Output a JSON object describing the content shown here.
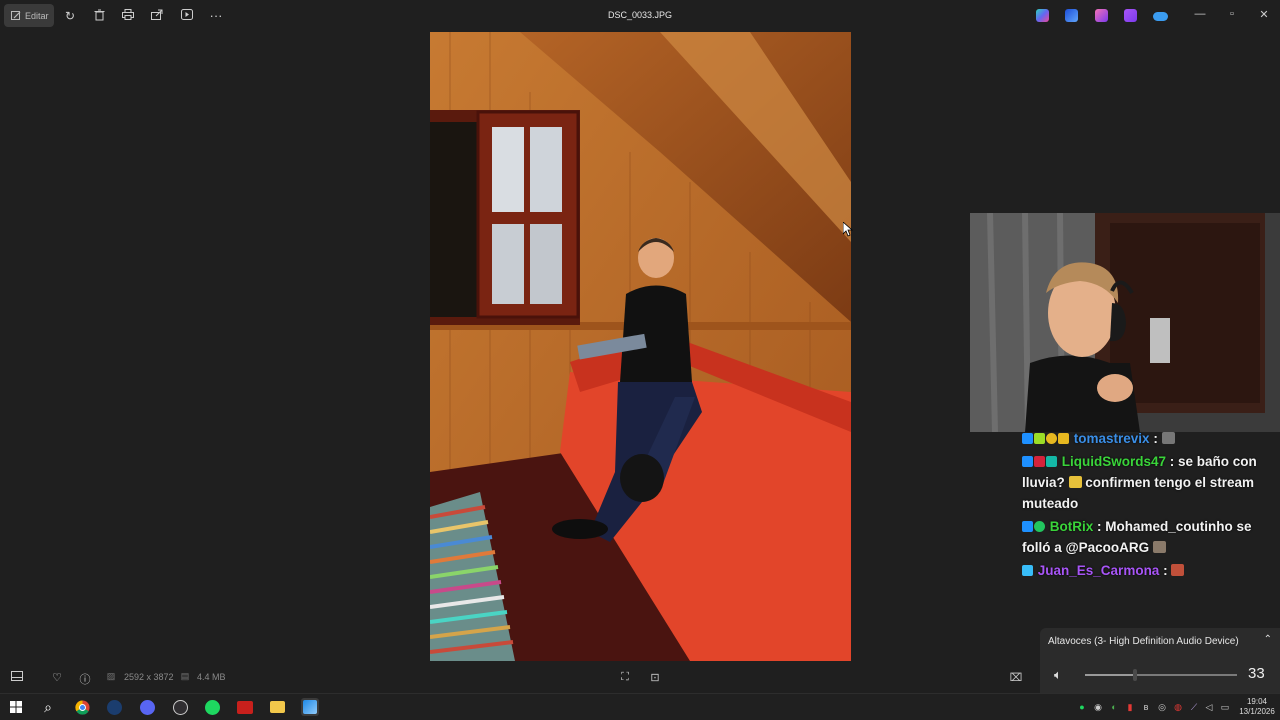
{
  "toolbar": {
    "edit_label": "Editar",
    "file_title": "DSC_0033.JPG",
    "icons": [
      "rotate-icon",
      "delete-icon",
      "print-icon",
      "share-icon",
      "slideshow-icon",
      "more-icon"
    ],
    "right_apps": [
      "copilot-icon",
      "clipchamp-icon",
      "designer-icon",
      "paint-icon",
      "onedrive-icon"
    ],
    "window_controls": [
      "minimize",
      "maximize",
      "close"
    ]
  },
  "chat": {
    "messages": [
      {
        "user": "tomastrevix",
        "user_color": "#3a8ee6",
        "text": " : ",
        "badges": [
          "#1e90ff",
          "#e7b820",
          "#e7b820",
          "#e7b820"
        ]
      },
      {
        "user": "LiquidSwords47",
        "user_color": "#3ad43a",
        "text": " : se baño con lluvia? ",
        "text2": " confirmen tengo el stream muteado",
        "badges": [
          "#1e90ff",
          "#7c3aed",
          "#14b8a6"
        ]
      },
      {
        "user": "BotRix",
        "user_color": "#3ad43a",
        "text": " : Mohamed_coutinho se folló a @PacooARG ",
        "badges": [
          "#1e90ff",
          "#22c55e"
        ]
      },
      {
        "user": "Juan_Es_Carmona",
        "user_color": "#a855f7",
        "text": " : ",
        "badges": [
          "#38bdf8"
        ]
      }
    ]
  },
  "bottom_bar": {
    "dimensions": "2592 x 3872",
    "file_size": "4.4 MB"
  },
  "volume": {
    "device_label": "Altavoces (3- High Definition Audio Device)",
    "level": 33
  },
  "clock": {
    "time": "19:04",
    "date": "13/1/2026"
  }
}
